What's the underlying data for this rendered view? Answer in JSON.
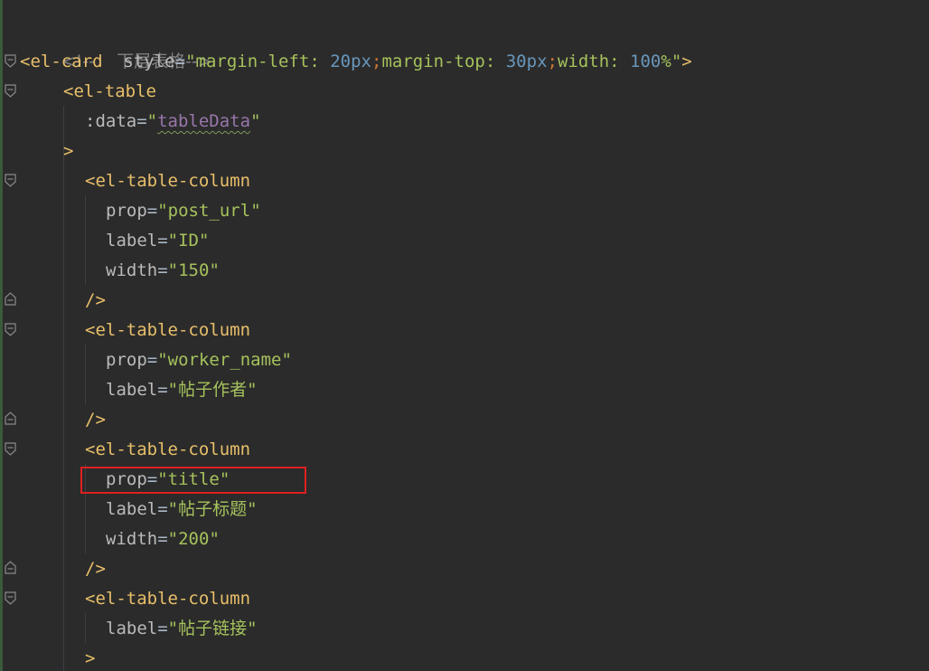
{
  "editor": {
    "lines": [
      {
        "comment": "<!--    下层表格-->"
      },
      {
        "tag": "<el-card",
        "attr": "style",
        "str_open": "\"margin-left: ",
        "num1": "20",
        "px1": "px",
        "semi1": ";",
        "mid": "margin-top: ",
        "num2": "30",
        "px2": "px",
        "semi2": ";",
        "mid2": "width: ",
        "num3": "100",
        "pct": "%",
        "str_close": "\"",
        "end": ">"
      },
      {
        "tag": "<el-table"
      },
      {
        "attr": ":data",
        "value": "tableData"
      },
      {
        "end": ">"
      },
      {
        "tag": "<el-table-column"
      },
      {
        "attr": "prop",
        "value": "post_url"
      },
      {
        "attr": "label",
        "value": "ID"
      },
      {
        "attr": "width",
        "value": "150"
      },
      {
        "end": "/>"
      },
      {
        "tag": "<el-table-column"
      },
      {
        "attr": "prop",
        "value": "worker_name"
      },
      {
        "attr": "label",
        "value": "帖子作者"
      },
      {
        "end": "/>"
      },
      {
        "tag": "<el-table-column"
      },
      {
        "attr": "prop",
        "value": "title"
      },
      {
        "attr": "label",
        "value": "帖子标题"
      },
      {
        "attr": "width",
        "value": "200"
      },
      {
        "end": "/>"
      },
      {
        "tag": "<el-table-column"
      },
      {
        "attr": "label",
        "value": "帖子链接"
      },
      {
        "end": ">"
      }
    ],
    "icons": {
      "fold_open": "fold-open-icon",
      "fold_close": "fold-close-icon"
    },
    "colors": {
      "background": "#2b2b2b",
      "tag": "#e8bf6a",
      "string": "#a5c25c",
      "number": "#6897bb",
      "keyword": "#cc7832",
      "highlight": "#e02020"
    }
  }
}
